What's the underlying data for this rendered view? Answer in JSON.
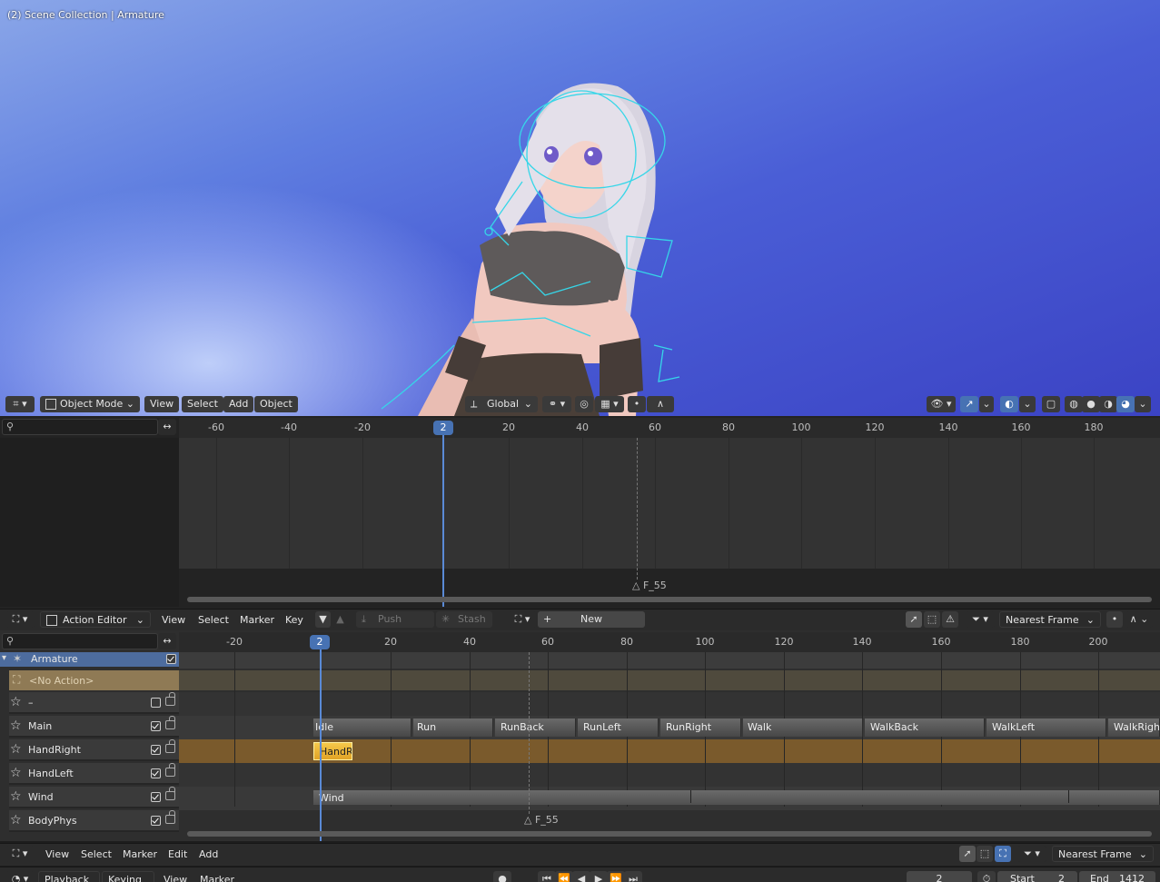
{
  "viewport": {
    "title": "(2) Scene Collection | Armature",
    "mode": "Object Mode",
    "menus": [
      "View",
      "Select",
      "Add",
      "Object"
    ],
    "orientation": "Global"
  },
  "timeline_top": {
    "ticks": [
      "-60",
      "-40",
      "-20",
      "20",
      "40",
      "60",
      "80",
      "100",
      "120",
      "140",
      "160",
      "180"
    ],
    "current_frame": "2",
    "marker": "F_55"
  },
  "action_editor": {
    "editor_type": "Action Editor",
    "menus": [
      "View",
      "Select",
      "Marker",
      "Key"
    ],
    "push_down": "Push Down",
    "stash": "Stash",
    "new_label": "New",
    "snap": "Nearest Frame"
  },
  "nla": {
    "ticks": [
      "-20",
      "20",
      "40",
      "60",
      "80",
      "100",
      "120",
      "140",
      "160",
      "180",
      "200"
    ],
    "current_frame": "2",
    "object": "Armature",
    "no_action": "<No Action>",
    "tracks": [
      {
        "name": "–",
        "checked": false
      },
      {
        "name": "Main",
        "checked": true
      },
      {
        "name": "HandRight",
        "checked": true
      },
      {
        "name": "HandLeft",
        "checked": true
      },
      {
        "name": "Wind",
        "checked": true
      },
      {
        "name": "BodyPhys",
        "checked": true
      }
    ],
    "main_strips": [
      "Idle",
      "Run",
      "RunBack",
      "RunLeft",
      "RunRight",
      "Walk",
      "WalkBack",
      "WalkLeft",
      "WalkRight"
    ],
    "handright_strip": "HandRela",
    "wind_strip": "Wind",
    "marker": "F_55",
    "menus": [
      "View",
      "Select",
      "Marker",
      "Edit",
      "Add"
    ],
    "snap": "Nearest Frame"
  },
  "playback_bar": {
    "menus": [
      "Playback",
      "Keying",
      "View",
      "Marker"
    ],
    "current": "2",
    "start_label": "Start",
    "start": "2",
    "end_label": "End",
    "end": "1412"
  }
}
